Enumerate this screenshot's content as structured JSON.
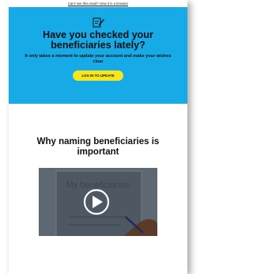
{
  "header": {
    "view_in_browser_link": "Can't see this email? View it in a browser"
  },
  "hero": {
    "icon": "document-pen-icon",
    "title": "Have you checked your beneficiaries lately?",
    "subtitle": "It only takes a moment to update your account and make your wishes clear",
    "cta_label": "LOG IN TO UPDATE",
    "background_color": "#16aae6",
    "cta_color": "#f6e61b"
  },
  "section": {
    "heading": "Why naming beneficiaries is important"
  },
  "video": {
    "thumbnail_text": "My beneficiaries:",
    "play_icon": "play-icon"
  }
}
